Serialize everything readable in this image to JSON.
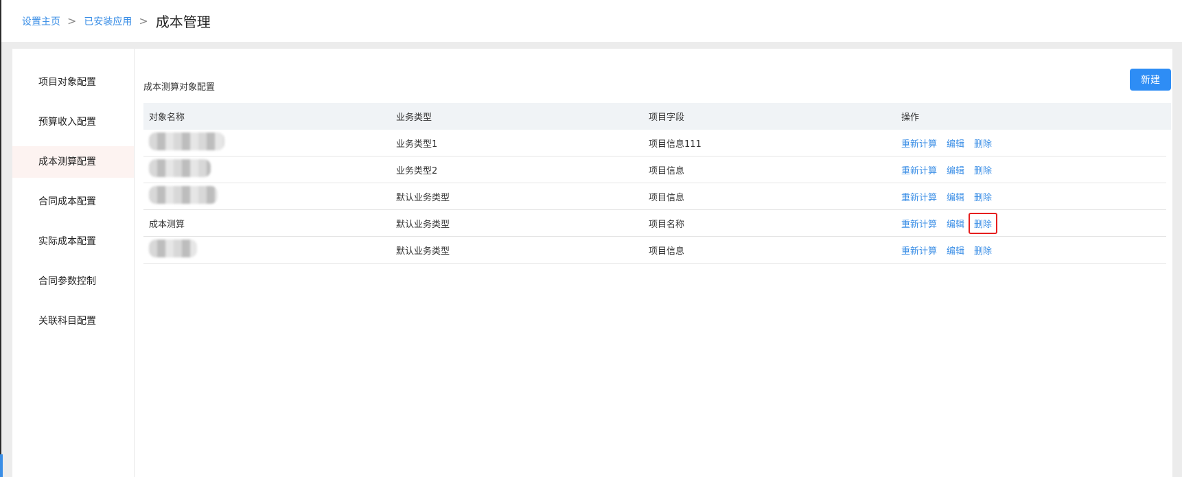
{
  "breadcrumb": {
    "items": [
      "设置主页",
      "已安装应用"
    ],
    "separator": ">",
    "current": "成本管理"
  },
  "sidebar": {
    "items": [
      {
        "label": "项目对象配置",
        "active": false
      },
      {
        "label": "预算收入配置",
        "active": false
      },
      {
        "label": "成本测算配置",
        "active": true
      },
      {
        "label": "合同成本配置",
        "active": false
      },
      {
        "label": "实际成本配置",
        "active": false
      },
      {
        "label": "合同参数控制",
        "active": false
      },
      {
        "label": "关联科目配置",
        "active": false
      }
    ]
  },
  "main": {
    "section_title": "成本测算对象配置",
    "new_button": "新建",
    "table": {
      "headers": [
        "对象名称",
        "业务类型",
        "项目字段",
        "操作"
      ],
      "rows": [
        {
          "name": "",
          "name_redacted": true,
          "type": "业务类型1",
          "field": "项目信息111"
        },
        {
          "name": "",
          "name_redacted": true,
          "type": "业务类型2",
          "field": "项目信息"
        },
        {
          "name": "",
          "name_redacted": true,
          "type": "默认业务类型",
          "field": "项目信息"
        },
        {
          "name": "成本测算",
          "name_redacted": false,
          "type": "默认业务类型",
          "field": "项目名称"
        },
        {
          "name": "",
          "name_redacted": true,
          "type": "默认业务类型",
          "field": "项目信息"
        }
      ],
      "actions": {
        "recalc": "重新计算",
        "edit": "编辑",
        "delete": "删除"
      }
    }
  },
  "colors": {
    "link": "#3a8ee6",
    "primary_button": "#2e8df5",
    "highlight_border": "#e61e1e",
    "active_sidebar_bg": "#fdf3f1",
    "table_header_bg": "#f0f3f6"
  }
}
